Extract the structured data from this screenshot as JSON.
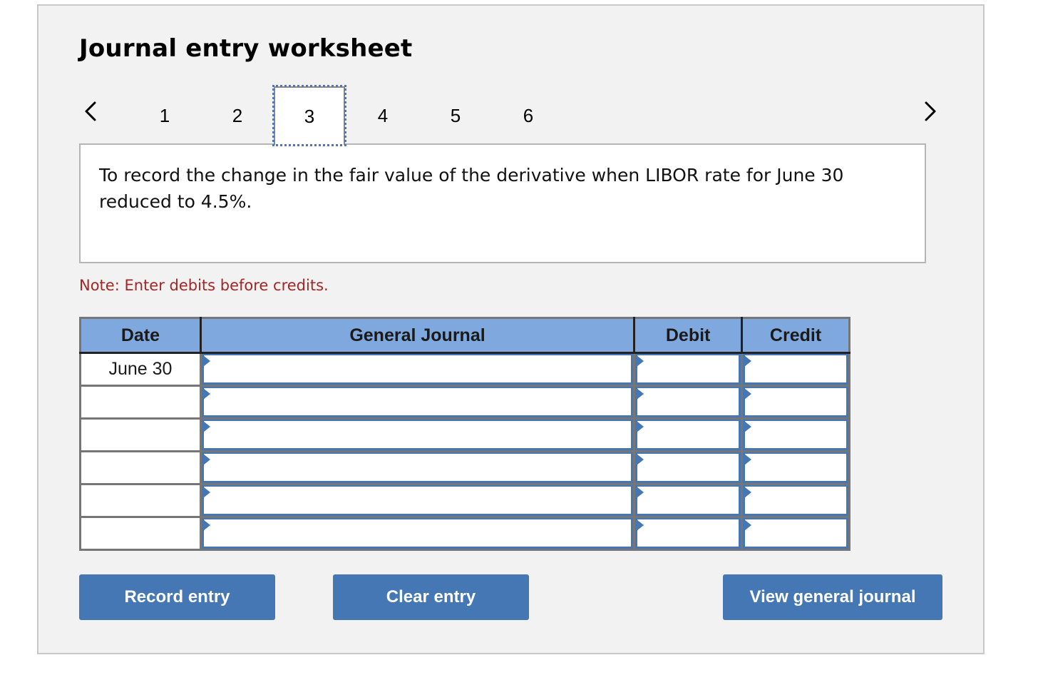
{
  "worksheet": {
    "title": "Journal entry worksheet",
    "navigation": {
      "prev_icon": "chevron-left-icon",
      "next_icon": "chevron-right-icon",
      "pages": [
        "1",
        "2",
        "3",
        "4",
        "5",
        "6"
      ],
      "active_page": "3"
    },
    "description": "To record the change in the fair value of the derivative when LIBOR rate for June 30 reduced to 4.5%.",
    "note": "Note: Enter debits before credits.",
    "table": {
      "headers": {
        "date": "Date",
        "general_journal": "General Journal",
        "debit": "Debit",
        "credit": "Credit"
      },
      "rows": [
        {
          "date": "June 30",
          "account": "",
          "debit": "",
          "credit": ""
        },
        {
          "date": "",
          "account": "",
          "debit": "",
          "credit": ""
        },
        {
          "date": "",
          "account": "",
          "debit": "",
          "credit": ""
        },
        {
          "date": "",
          "account": "",
          "debit": "",
          "credit": ""
        },
        {
          "date": "",
          "account": "",
          "debit": "",
          "credit": ""
        },
        {
          "date": "",
          "account": "",
          "debit": "",
          "credit": ""
        }
      ]
    },
    "buttons": {
      "record": "Record entry",
      "clear": "Clear entry",
      "view": "View general journal"
    },
    "colors": {
      "header_bg": "#7fa9de",
      "button_bg": "#4677b5",
      "note_text": "#a52525",
      "panel_bg": "#f2f2f2"
    }
  }
}
